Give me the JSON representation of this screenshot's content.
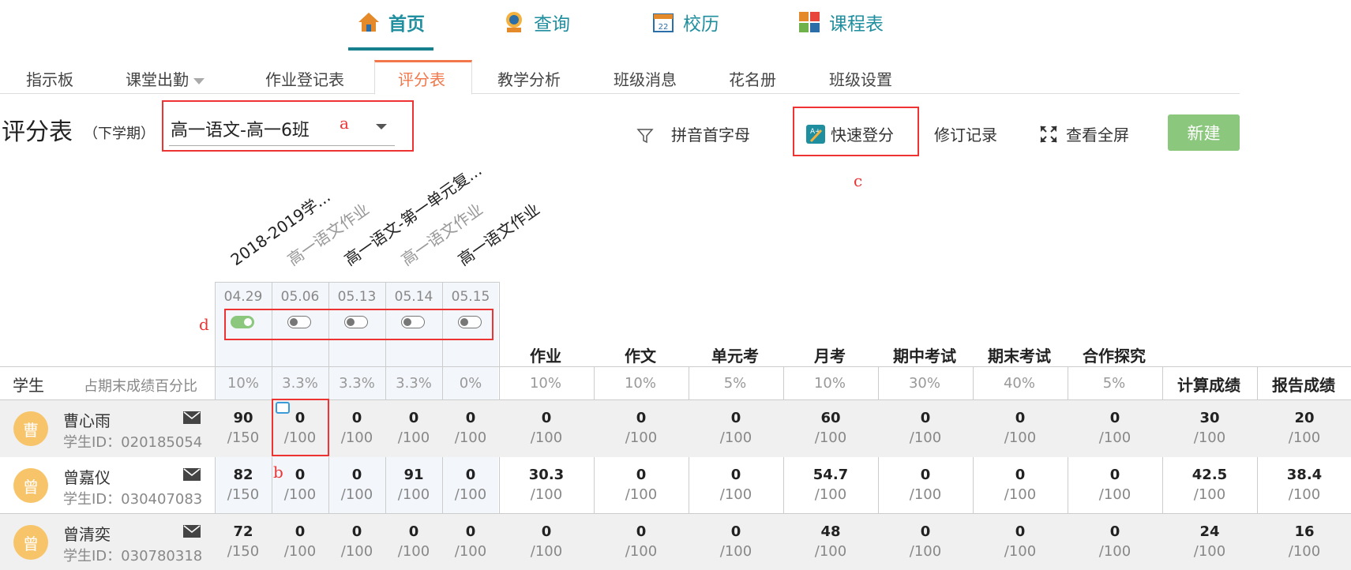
{
  "topnav": {
    "items": [
      {
        "label": "首页",
        "icon": "home-icon"
      },
      {
        "label": "查询",
        "icon": "search-person-icon"
      },
      {
        "label": "校历",
        "icon": "calendar-icon"
      },
      {
        "label": "课程表",
        "icon": "schedule-icon"
      }
    ]
  },
  "subnav": {
    "items": [
      "指示板",
      "课堂出勤",
      "作业登记表",
      "评分表",
      "教学分析",
      "班级消息",
      "花名册",
      "班级设置"
    ],
    "active": "评分表"
  },
  "page": {
    "title": "评分表",
    "term": "（下学期）",
    "class_select": "高一语文-高一6班"
  },
  "toolbar": {
    "pinyin": "拼音首字母",
    "quick_score": "快速登分",
    "history": "修订记录",
    "fullscreen": "查看全屏",
    "new": "新建"
  },
  "annotations": {
    "a": "a",
    "b": "b",
    "c": "c",
    "d": "d"
  },
  "assignments": [
    {
      "name": "2018-2019学...",
      "date": "04.29",
      "enabled": true,
      "weight": "10%"
    },
    {
      "name": "高一语文作业",
      "date": "05.06",
      "enabled": false,
      "weight": "3.3%"
    },
    {
      "name": "高一语文-第一单元复...",
      "date": "05.13",
      "enabled": false,
      "weight": "3.3%"
    },
    {
      "name": "高一语文作业",
      "date": "05.14",
      "enabled": false,
      "weight": "3.3%"
    },
    {
      "name": "高一语文作业",
      "date": "05.15",
      "enabled": false,
      "weight": "0%"
    }
  ],
  "categories": [
    {
      "name": "作业",
      "weight": "10%"
    },
    {
      "name": "作文",
      "weight": "10%"
    },
    {
      "name": "单元考",
      "weight": "5%"
    },
    {
      "name": "月考",
      "weight": "10%"
    },
    {
      "name": "期中考试",
      "weight": "30%"
    },
    {
      "name": "期末考试",
      "weight": "40%"
    },
    {
      "name": "合作探究",
      "weight": "5%"
    }
  ],
  "table": {
    "student_header": "学生",
    "weight_header": "占期末成绩百分比",
    "calc_header": "计算成绩",
    "report_header": "报告成绩",
    "id_prefix": "学生ID："
  },
  "students": [
    {
      "avatar": "曹",
      "name": "曹心雨",
      "id": "020185054",
      "scores": [
        [
          "90",
          "/150"
        ],
        [
          "0",
          "/100"
        ],
        [
          "0",
          "/100"
        ],
        [
          "0",
          "/100"
        ],
        [
          "0",
          "/100"
        ]
      ],
      "cats": [
        [
          "0",
          "/100"
        ],
        [
          "0",
          "/100"
        ],
        [
          "0",
          "/100"
        ],
        [
          "60",
          "/100"
        ],
        [
          "0",
          "/100"
        ],
        [
          "0",
          "/100"
        ],
        [
          "0",
          "/100"
        ]
      ],
      "calc": [
        "30",
        "/100"
      ],
      "report": [
        "20",
        "/100"
      ]
    },
    {
      "avatar": "曾",
      "name": "曾嘉仪",
      "id": "030407083",
      "scores": [
        [
          "82",
          "/150"
        ],
        [
          "0",
          "/100"
        ],
        [
          "0",
          "/100"
        ],
        [
          "91",
          "/100"
        ],
        [
          "0",
          "/100"
        ]
      ],
      "cats": [
        [
          "30.3",
          "/100"
        ],
        [
          "0",
          "/100"
        ],
        [
          "0",
          "/100"
        ],
        [
          "54.7",
          "/100"
        ],
        [
          "0",
          "/100"
        ],
        [
          "0",
          "/100"
        ],
        [
          "0",
          "/100"
        ]
      ],
      "calc": [
        "42.5",
        "/100"
      ],
      "report": [
        "38.4",
        "/100"
      ]
    },
    {
      "avatar": "曾",
      "name": "曾清奕",
      "id": "030780318",
      "scores": [
        [
          "72",
          "/150"
        ],
        [
          "0",
          "/100"
        ],
        [
          "0",
          "/100"
        ],
        [
          "0",
          "/100"
        ],
        [
          "0",
          "/100"
        ]
      ],
      "cats": [
        [
          "0",
          "/100"
        ],
        [
          "0",
          "/100"
        ],
        [
          "0",
          "/100"
        ],
        [
          "48",
          "/100"
        ],
        [
          "0",
          "/100"
        ],
        [
          "0",
          "/100"
        ],
        [
          "0",
          "/100"
        ]
      ],
      "calc": [
        "24",
        "/100"
      ],
      "report": [
        "16",
        "/100"
      ]
    }
  ],
  "colors": {
    "accent": "#f2784b",
    "nav": "#1f8e9e",
    "new_button": "#8cc77e",
    "annotation": "#ee3333"
  }
}
